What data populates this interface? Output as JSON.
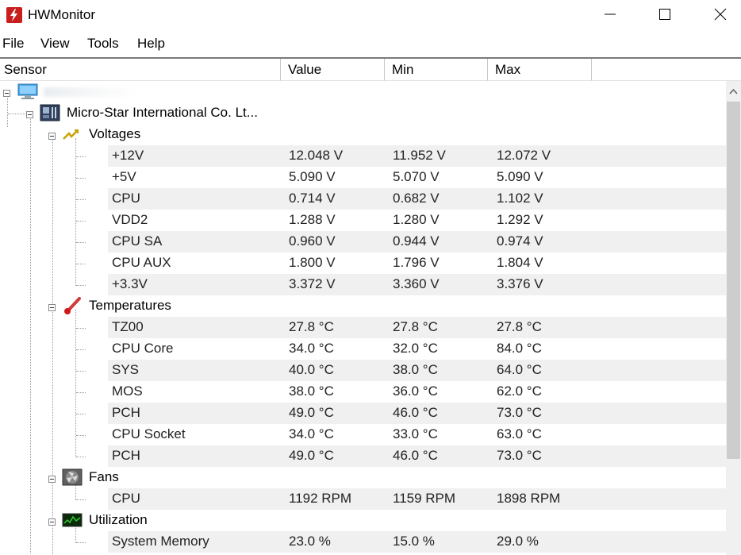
{
  "window": {
    "title": "HWMonitor",
    "accent_color": "#c81e1e"
  },
  "menu": [
    "File",
    "View",
    "Tools",
    "Help"
  ],
  "columns": {
    "sensor": "Sensor",
    "value": "Value",
    "min": "Min",
    "max": "Max"
  },
  "tree": {
    "board": "Micro-Star International Co. Lt...",
    "groups": {
      "voltages": {
        "label": "Voltages",
        "icon": "voltage-icon",
        "rows": [
          {
            "name": "+12V",
            "value": "12.048 V",
            "min": "11.952 V",
            "max": "12.072 V"
          },
          {
            "name": "+5V",
            "value": "5.090 V",
            "min": "5.070 V",
            "max": "5.090 V"
          },
          {
            "name": "CPU",
            "value": "0.714 V",
            "min": "0.682 V",
            "max": "1.102 V"
          },
          {
            "name": "VDD2",
            "value": "1.288 V",
            "min": "1.280 V",
            "max": "1.292 V"
          },
          {
            "name": "CPU SA",
            "value": "0.960 V",
            "min": "0.944 V",
            "max": "0.974 V"
          },
          {
            "name": "CPU AUX",
            "value": "1.800 V",
            "min": "1.796 V",
            "max": "1.804 V"
          },
          {
            "name": "+3.3V",
            "value": "3.372 V",
            "min": "3.360 V",
            "max": "3.376 V"
          }
        ]
      },
      "temperatures": {
        "label": "Temperatures",
        "icon": "thermometer-icon",
        "rows": [
          {
            "name": "TZ00",
            "value": "27.8 °C",
            "min": "27.8 °C",
            "max": "27.8 °C"
          },
          {
            "name": "CPU Core",
            "value": "34.0 °C",
            "min": "32.0 °C",
            "max": "84.0 °C"
          },
          {
            "name": "SYS",
            "value": "40.0 °C",
            "min": "38.0 °C",
            "max": "64.0 °C"
          },
          {
            "name": "MOS",
            "value": "38.0 °C",
            "min": "36.0 °C",
            "max": "62.0 °C"
          },
          {
            "name": "PCH",
            "value": "49.0 °C",
            "min": "46.0 °C",
            "max": "73.0 °C"
          },
          {
            "name": "CPU Socket",
            "value": "34.0 °C",
            "min": "33.0 °C",
            "max": "63.0 °C"
          },
          {
            "name": "PCH",
            "value": "49.0 °C",
            "min": "46.0 °C",
            "max": "73.0 °C"
          }
        ]
      },
      "fans": {
        "label": "Fans",
        "icon": "fan-icon",
        "rows": [
          {
            "name": "CPU",
            "value": "1192 RPM",
            "min": "1159 RPM",
            "max": "1898 RPM"
          }
        ]
      },
      "utilization": {
        "label": "Utilization",
        "icon": "utilization-icon",
        "rows": [
          {
            "name": "System Memory",
            "value": "23.0 %",
            "min": "15.0 %",
            "max": "29.0 %"
          }
        ]
      }
    }
  }
}
